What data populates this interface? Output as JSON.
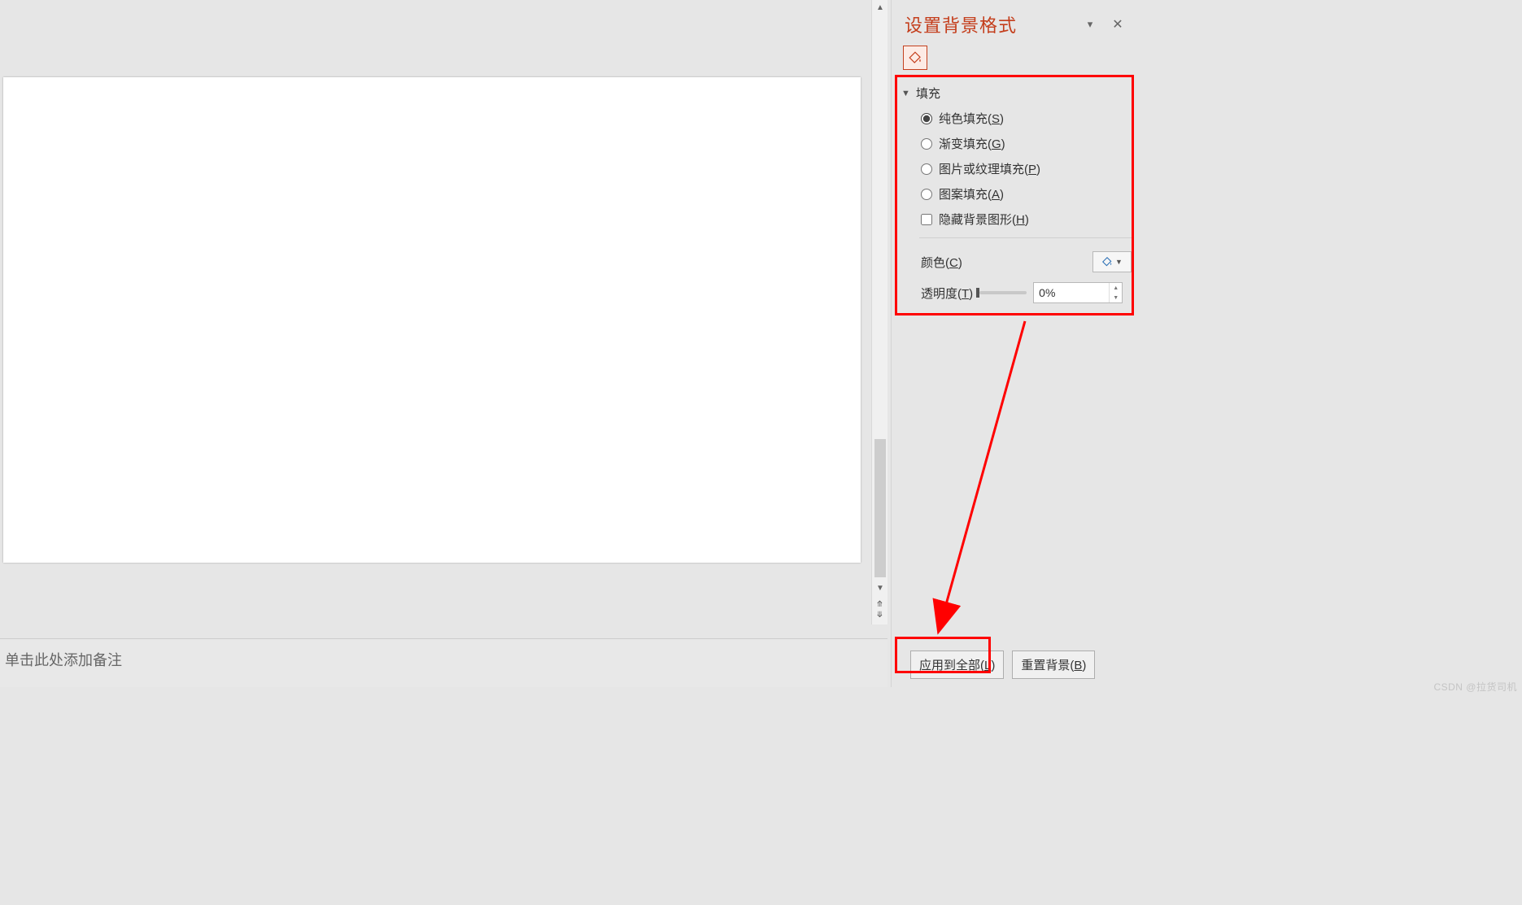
{
  "panel": {
    "title": "设置背景格式",
    "fill_icon": "paint-bucket-icon",
    "section_label": "填充",
    "options": {
      "solid": {
        "label_pre": "纯色填充(",
        "hotkey": "S",
        "label_post": ")",
        "checked": true
      },
      "gradient": {
        "label_pre": "渐变填充(",
        "hotkey": "G",
        "label_post": ")",
        "checked": false
      },
      "picture": {
        "label_pre": "图片或纹理填充(",
        "hotkey": "P",
        "label_post": ")",
        "checked": false
      },
      "pattern": {
        "label_pre": "图案填充(",
        "hotkey": "A",
        "label_post": ")",
        "checked": false
      },
      "hidebg": {
        "label_pre": "隐藏背景图形(",
        "hotkey": "H",
        "label_post": ")",
        "checked": false
      }
    },
    "color_row": {
      "label_pre": "颜色(",
      "hotkey": "C",
      "label_post": ")"
    },
    "transparency_row": {
      "label_pre": "透明度(",
      "hotkey": "T",
      "label_post": ")",
      "value": "0%"
    },
    "actions": {
      "apply_all": {
        "label_pre": "应用到全部(",
        "hotkey": "L",
        "label_post": ")"
      },
      "reset": {
        "label_pre": "重置背景(",
        "hotkey": "B",
        "label_post": ")"
      }
    }
  },
  "notes": {
    "placeholder": "单击此处添加备注"
  },
  "watermark": "CSDN @拉货司机"
}
